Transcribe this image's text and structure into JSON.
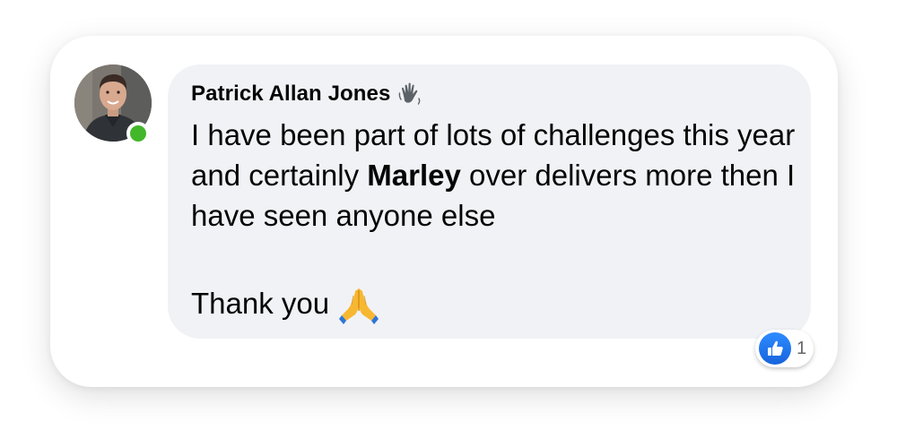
{
  "comment": {
    "author": "Patrick Allan Jones",
    "author_badge_icon": "waving-hand-icon",
    "online": true,
    "text_before": "I have been part of lots of challenges this year and certainly ",
    "text_bold": "Marley",
    "text_after": " over delivers more then I have seen anyone else",
    "closing": "Thank you",
    "closing_icon": "folded-hands-icon"
  },
  "reactions": {
    "icon": "like-icon",
    "count": "1"
  },
  "colors": {
    "bubble": "#f0f2f5",
    "online": "#42b72a",
    "like": "#1877f2",
    "text": "#050505",
    "muted": "#65676b"
  }
}
